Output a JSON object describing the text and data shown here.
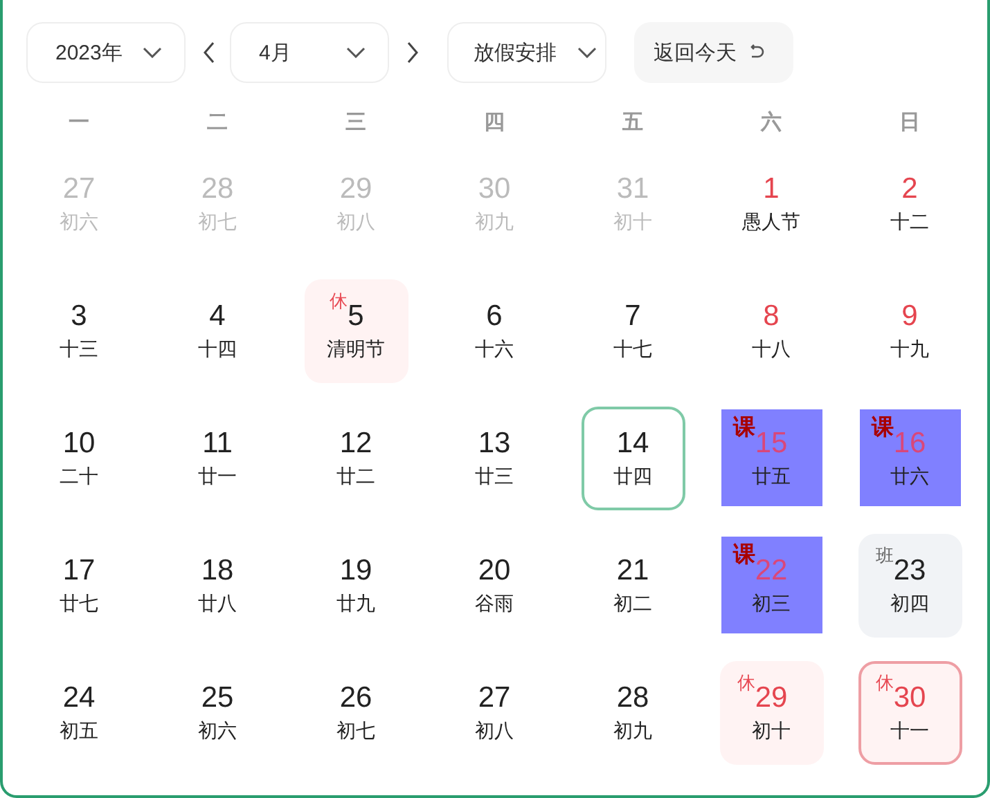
{
  "toolbar": {
    "year": "2023年",
    "month": "4月",
    "holiday_menu": "放假安排",
    "today_button": "返回今天"
  },
  "weekdays": [
    "一",
    "二",
    "三",
    "四",
    "五",
    "六",
    "日"
  ],
  "days": [
    {
      "day": "27",
      "lunar": "初六",
      "other_month": true,
      "emphasis": false,
      "today": false,
      "selected": false
    },
    {
      "day": "28",
      "lunar": "初七",
      "other_month": true,
      "emphasis": false,
      "today": false,
      "selected": false
    },
    {
      "day": "29",
      "lunar": "初八",
      "other_month": true,
      "emphasis": false,
      "today": false,
      "selected": false
    },
    {
      "day": "30",
      "lunar": "初九",
      "other_month": true,
      "emphasis": false,
      "today": false,
      "selected": false
    },
    {
      "day": "31",
      "lunar": "初十",
      "other_month": true,
      "emphasis": false,
      "today": false,
      "selected": false
    },
    {
      "day": "1",
      "lunar": "愚人节",
      "other_month": false,
      "emphasis": true,
      "today": false,
      "selected": false
    },
    {
      "day": "2",
      "lunar": "十二",
      "other_month": false,
      "emphasis": true,
      "today": false,
      "selected": false
    },
    {
      "day": "3",
      "lunar": "十三",
      "other_month": false,
      "emphasis": false,
      "today": false,
      "selected": false
    },
    {
      "day": "4",
      "lunar": "十四",
      "other_month": false,
      "emphasis": false,
      "today": false,
      "selected": false
    },
    {
      "day": "5",
      "lunar": "清明节",
      "other_month": false,
      "emphasis": false,
      "today": false,
      "selected": false,
      "badge": {
        "text": "休",
        "kind": "rest"
      }
    },
    {
      "day": "6",
      "lunar": "十六",
      "other_month": false,
      "emphasis": false,
      "today": false,
      "selected": false
    },
    {
      "day": "7",
      "lunar": "十七",
      "other_month": false,
      "emphasis": false,
      "today": false,
      "selected": false
    },
    {
      "day": "8",
      "lunar": "十八",
      "other_month": false,
      "emphasis": true,
      "today": false,
      "selected": false
    },
    {
      "day": "9",
      "lunar": "十九",
      "other_month": false,
      "emphasis": true,
      "today": false,
      "selected": false
    },
    {
      "day": "10",
      "lunar": "二十",
      "other_month": false,
      "emphasis": false,
      "today": false,
      "selected": false
    },
    {
      "day": "11",
      "lunar": "廿一",
      "other_month": false,
      "emphasis": false,
      "today": false,
      "selected": false
    },
    {
      "day": "12",
      "lunar": "廿二",
      "other_month": false,
      "emphasis": false,
      "today": false,
      "selected": false
    },
    {
      "day": "13",
      "lunar": "廿三",
      "other_month": false,
      "emphasis": false,
      "today": false,
      "selected": false
    },
    {
      "day": "14",
      "lunar": "廿四",
      "other_month": false,
      "emphasis": false,
      "today": true,
      "selected": false
    },
    {
      "day": "15",
      "lunar": "廿五",
      "other_month": false,
      "emphasis": true,
      "today": false,
      "selected": false,
      "badge": {
        "text": "课",
        "kind": "course"
      }
    },
    {
      "day": "16",
      "lunar": "廿六",
      "other_month": false,
      "emphasis": true,
      "today": false,
      "selected": false,
      "badge": {
        "text": "课",
        "kind": "course"
      }
    },
    {
      "day": "17",
      "lunar": "廿七",
      "other_month": false,
      "emphasis": false,
      "today": false,
      "selected": false
    },
    {
      "day": "18",
      "lunar": "廿八",
      "other_month": false,
      "emphasis": false,
      "today": false,
      "selected": false
    },
    {
      "day": "19",
      "lunar": "廿九",
      "other_month": false,
      "emphasis": false,
      "today": false,
      "selected": false
    },
    {
      "day": "20",
      "lunar": "谷雨",
      "other_month": false,
      "emphasis": false,
      "today": false,
      "selected": false
    },
    {
      "day": "21",
      "lunar": "初二",
      "other_month": false,
      "emphasis": false,
      "today": false,
      "selected": false
    },
    {
      "day": "22",
      "lunar": "初三",
      "other_month": false,
      "emphasis": true,
      "today": false,
      "selected": false,
      "badge": {
        "text": "课",
        "kind": "course"
      }
    },
    {
      "day": "23",
      "lunar": "初四",
      "other_month": false,
      "emphasis": false,
      "today": false,
      "selected": false,
      "badge": {
        "text": "班",
        "kind": "work"
      }
    },
    {
      "day": "24",
      "lunar": "初五",
      "other_month": false,
      "emphasis": false,
      "today": false,
      "selected": false
    },
    {
      "day": "25",
      "lunar": "初六",
      "other_month": false,
      "emphasis": false,
      "today": false,
      "selected": false
    },
    {
      "day": "26",
      "lunar": "初七",
      "other_month": false,
      "emphasis": false,
      "today": false,
      "selected": false
    },
    {
      "day": "27",
      "lunar": "初八",
      "other_month": false,
      "emphasis": false,
      "today": false,
      "selected": false
    },
    {
      "day": "28",
      "lunar": "初九",
      "other_month": false,
      "emphasis": false,
      "today": false,
      "selected": false
    },
    {
      "day": "29",
      "lunar": "初十",
      "other_month": false,
      "emphasis": true,
      "today": false,
      "selected": false,
      "badge": {
        "text": "休",
        "kind": "rest"
      }
    },
    {
      "day": "30",
      "lunar": "十一",
      "other_month": false,
      "emphasis": true,
      "today": false,
      "selected": true,
      "badge": {
        "text": "休",
        "kind": "rest"
      }
    }
  ]
}
